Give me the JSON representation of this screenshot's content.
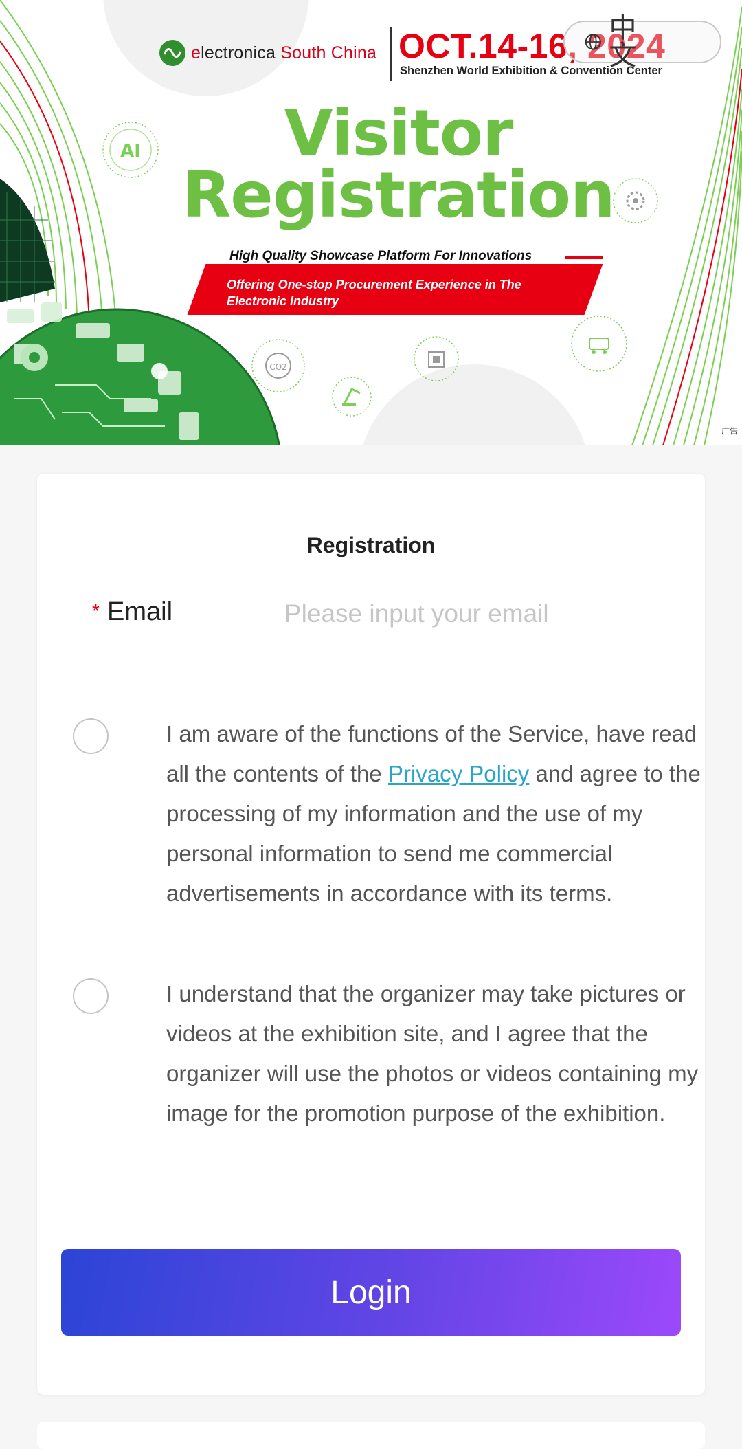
{
  "banner": {
    "logo_prefix_e": "e",
    "logo_word": "lectronica",
    "logo_region": "South China",
    "date": "OCT.14-16, 2024",
    "venue": "Shenzhen World Exhibition & Convention Center",
    "language_toggle": "中 文",
    "title_line1": "Visitor",
    "title_line2": "Registration",
    "tagline": "High Quality Showcase Platform For Innovations",
    "subtagline": "Offering One-stop Procurement Experience in The Electronic Industry",
    "ad_label": "广告",
    "accent_green": "#6dc043",
    "accent_red": "#e60012",
    "icons": [
      "ai-icon",
      "gear-icon",
      "co2-icon",
      "chip-icon",
      "robot-arm-icon",
      "robot-icon"
    ]
  },
  "form": {
    "title": "Registration",
    "email_required_mark": "*",
    "email_label": "Email",
    "email_placeholder": "Please input your email",
    "email_value": "",
    "consent1_before": "I am aware of the functions of the Service, have read all the contents of the ",
    "consent1_link": "Privacy Policy",
    "consent1_after": " and agree to the processing of my information and the use of my personal information to send me commercial advertisements in accordance with its terms.",
    "consent1_checked": false,
    "consent2": "I understand that the organizer may take pictures or videos at the exhibition site, and I agree that the organizer will use the photos or videos containing my image for the promotion purpose of the exhibition.",
    "consent2_checked": false,
    "login_label": "Login",
    "button_gradient": [
      "#2b45d6",
      "#9c49fb"
    ],
    "link_color": "#2ba5c4"
  }
}
